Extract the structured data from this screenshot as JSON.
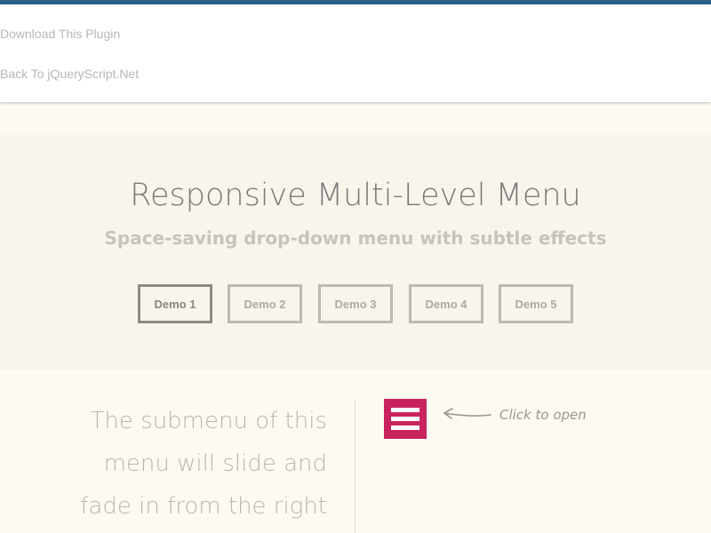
{
  "header": {
    "links": [
      {
        "label": "Download This Plugin"
      },
      {
        "label": "Back To jQueryScript.Net"
      }
    ]
  },
  "intro": {
    "title": "Responsive Multi-Level Menu",
    "subtitle": "Space-saving drop-down menu with subtle effects",
    "demos": [
      {
        "label": "Demo 1",
        "active": true
      },
      {
        "label": "Demo 2",
        "active": false
      },
      {
        "label": "Demo 3",
        "active": false
      },
      {
        "label": "Demo 4",
        "active": false
      },
      {
        "label": "Demo 5",
        "active": false
      }
    ]
  },
  "content": {
    "description_lines": [
      "The submenu of this",
      "menu will slide and",
      "fade in from the right"
    ],
    "menu_icon": "hamburger-icon",
    "hint": "Click to open"
  },
  "colors": {
    "top_strip": "#2c5f8a",
    "menu_button": "#c9235f",
    "page_background": "#fdfaf2",
    "intro_background": "#f9f5ec"
  }
}
